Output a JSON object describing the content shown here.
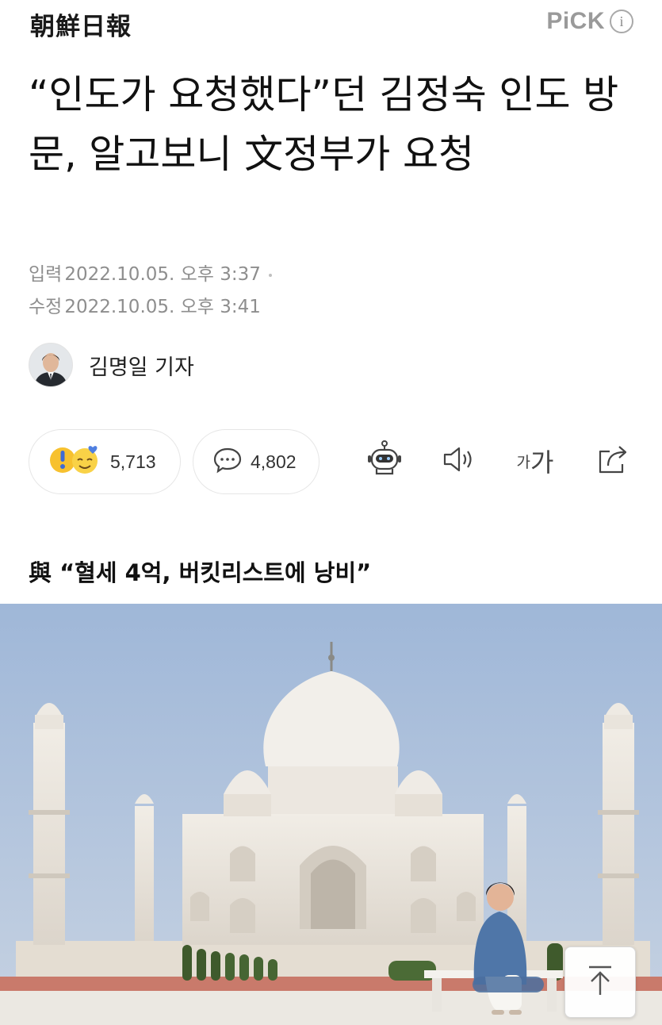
{
  "header": {
    "publisher": "朝鮮日報",
    "pick_label": "PiCK",
    "info_label": "i"
  },
  "article": {
    "headline": "“인도가 요청했다”던 김정숙 인도 방문, 알고보니 文정부가 요청",
    "published_label": "입력",
    "published": "2022.10.05. 오후 3:37",
    "modified_label": "수정",
    "modified": "2022.10.05. 오후 3:41",
    "reporter": "김명일 기자",
    "subheading": "與 “혈세 4억, 버킷리스트에 낭비”"
  },
  "actions": {
    "reactions_count": "5,713",
    "comments_count": "4,802",
    "font_size_small": "가",
    "font_size_large": "가"
  },
  "icons": {
    "info": "info-circle-icon",
    "reactions": "emoji-reactions-icon",
    "comments": "speech-bubble-icon",
    "summary_bot": "robot-summary-icon",
    "listen": "speaker-icon",
    "font_size": "font-size-icon",
    "share": "share-icon",
    "scroll_top": "arrow-up-icon"
  },
  "colors": {
    "text": "#111111",
    "meta": "#8e8e8e",
    "pick": "#9a9a9a",
    "border": "#e6e6e6",
    "sky": "#a9bfdc"
  }
}
